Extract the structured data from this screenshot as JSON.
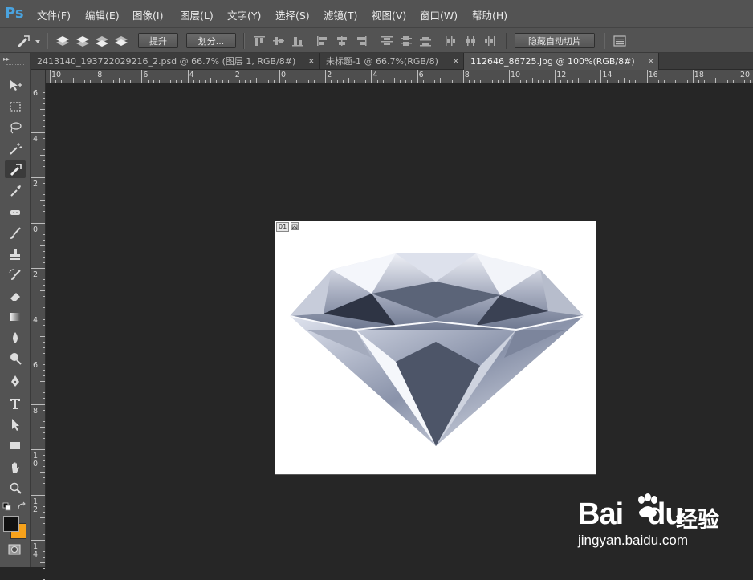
{
  "app": {
    "logo": "Ps"
  },
  "menu": [
    "文件(F)",
    "编辑(E)",
    "图像(I)",
    "图层(L)",
    "文字(Y)",
    "选择(S)",
    "滤镜(T)",
    "视图(V)",
    "窗口(W)",
    "帮助(H)"
  ],
  "options_bar": {
    "promote_label": "提升",
    "divide_label": "划分...",
    "hide_auto_slices_label": "隐藏自动切片"
  },
  "tabs": [
    {
      "label": "2413140_193722029216_2.psd @ 66.7% (图层 1, RGB/8#)",
      "close": "×",
      "active": false
    },
    {
      "label": "未标题-1 @ 66.7%(RGB/8)",
      "close": "×",
      "active": false
    },
    {
      "label": "112646_86725.jpg @ 100%(RGB/8#)",
      "close": "×",
      "active": true
    }
  ],
  "ruler_top_labels": [
    "10",
    "8",
    "6",
    "4",
    "2",
    "0",
    "2",
    "4",
    "6",
    "8",
    "10",
    "12",
    "14",
    "16",
    "18",
    "20"
  ],
  "ruler_left_labels": [
    "6",
    "4",
    "2",
    "0",
    "2",
    "4",
    "6",
    "8",
    "1\n0",
    "1\n2",
    "1\n4"
  ],
  "document": {
    "slice_number": "01"
  },
  "colors": {
    "foreground": "#111111",
    "background": "#f7a21b",
    "panel": "#535353",
    "workspace": "#262626",
    "accent": "#4aa3df"
  },
  "tools": [
    "move-icon",
    "marquee-icon",
    "lasso-icon",
    "magic-wand-icon",
    "slice-icon",
    "eyedropper-icon",
    "healing-brush-icon",
    "brush-icon",
    "clone-stamp-icon",
    "history-brush-icon",
    "eraser-icon",
    "gradient-icon",
    "blur-icon",
    "dodge-icon",
    "pen-icon",
    "type-icon",
    "path-selection-icon",
    "rectangle-icon",
    "hand-icon",
    "zoom-icon"
  ],
  "watermark": {
    "brand": "Bai",
    "brand2": "du",
    "cn": "经验",
    "url": "jingyan.baidu.com"
  }
}
